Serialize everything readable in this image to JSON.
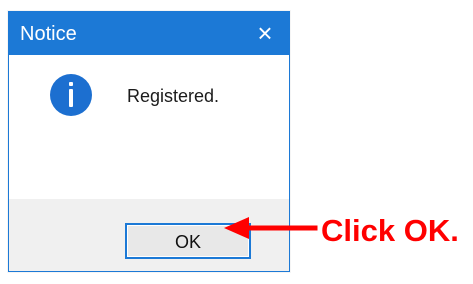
{
  "dialog": {
    "title": "Notice",
    "close_glyph": "×",
    "message": "Registered.",
    "icon": "info-icon",
    "ok_label": "OK",
    "accent_color": "#1c79d6",
    "footer_color": "#f0f0f0"
  },
  "annotation": {
    "text": "Click OK.",
    "color": "#ff0000",
    "icon": "left-arrow-icon"
  }
}
